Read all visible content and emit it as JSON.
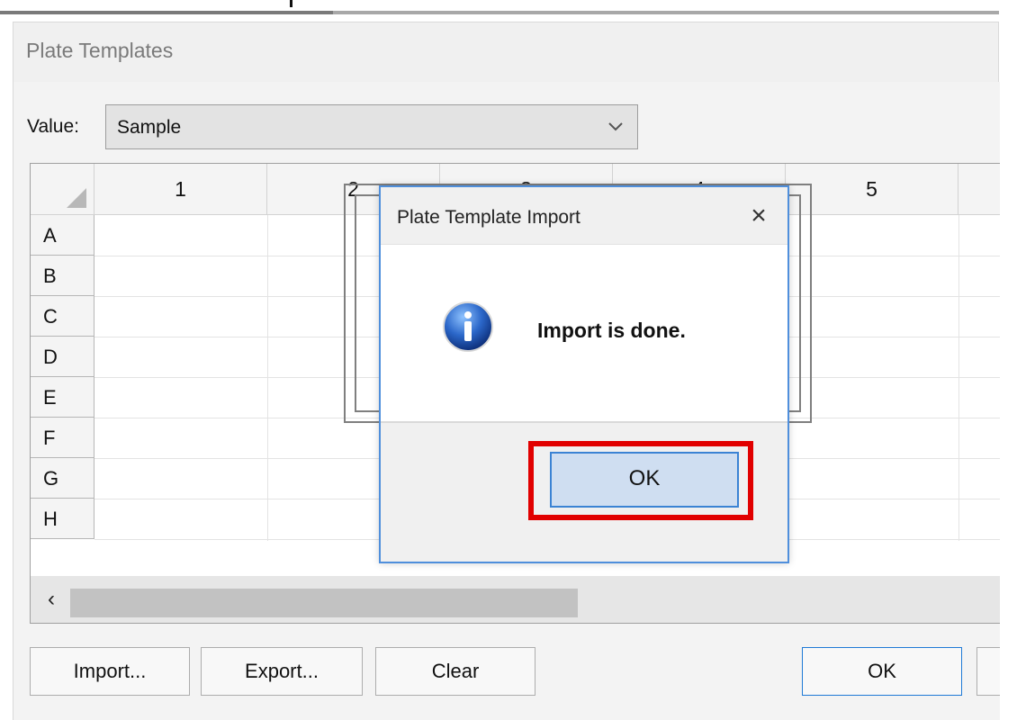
{
  "window": {
    "title": "Plate Templates"
  },
  "value": {
    "label": "Value:",
    "selected": "Sample"
  },
  "grid": {
    "columns": [
      "1",
      "2",
      "3",
      "4",
      "5"
    ],
    "rows": [
      "A",
      "B",
      "C",
      "D",
      "E",
      "F",
      "G",
      "H"
    ]
  },
  "buttons": {
    "import": "Import...",
    "export": "Export...",
    "clear": "Clear",
    "ok": "OK"
  },
  "dialog": {
    "title": "Plate Template Import",
    "message": "Import is done.",
    "ok_label": "OK"
  },
  "colors": {
    "dialog_border": "#4f8fdc",
    "highlight": "#e10000",
    "ok_button_bg": "#cfdef1"
  },
  "icons": {
    "info": "information-icon",
    "close": "close-icon",
    "dropdown": "chevron-down-icon",
    "scroll_left": "scroll-left-arrow-icon"
  }
}
